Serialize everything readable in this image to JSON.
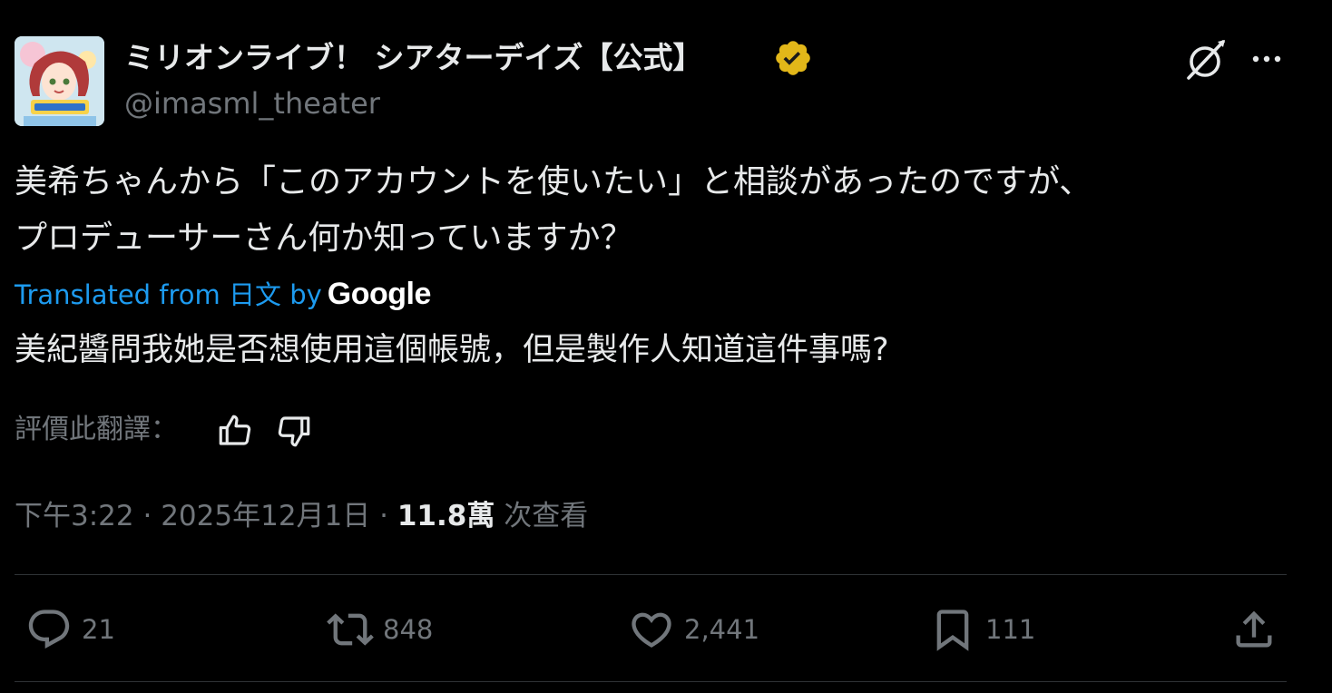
{
  "author": {
    "name": "ミリオンライブ！ シアターデイズ【公式】",
    "handle": "@imasml_theater",
    "verified": true
  },
  "tweet": {
    "text": "美希ちゃんから「このアカウントを使いたい」と相談があったのですが、\nプロデューサーさん何か知っていますか？",
    "translated_from": "Translated from 日文 by",
    "translator": "Google",
    "translation": "美紀醬問我她是否想使用這個帳號，但是製作人知道這件事嗎?"
  },
  "rate": {
    "label": "評價此翻譯："
  },
  "meta": {
    "time": "下午3:22",
    "sep1": "·",
    "date": "2025年12月1日",
    "sep2": "·",
    "views": "11.8萬",
    "views_label": "次查看"
  },
  "actions": {
    "replies": "21",
    "reposts": "848",
    "likes": "2,441",
    "bookmarks": "111"
  },
  "colors": {
    "background": "#000000",
    "text": "#e7e9ea",
    "muted": "#71767b",
    "link": "#1d9bf0",
    "badge": "#e2b719",
    "divider": "#2f3336"
  },
  "icons": [
    "avatar",
    "verified-badge-icon",
    "grok-icon",
    "more-icon",
    "thumbs-up-icon",
    "thumbs-down-icon",
    "reply-icon",
    "repost-icon",
    "like-icon",
    "bookmark-icon",
    "share-icon"
  ]
}
